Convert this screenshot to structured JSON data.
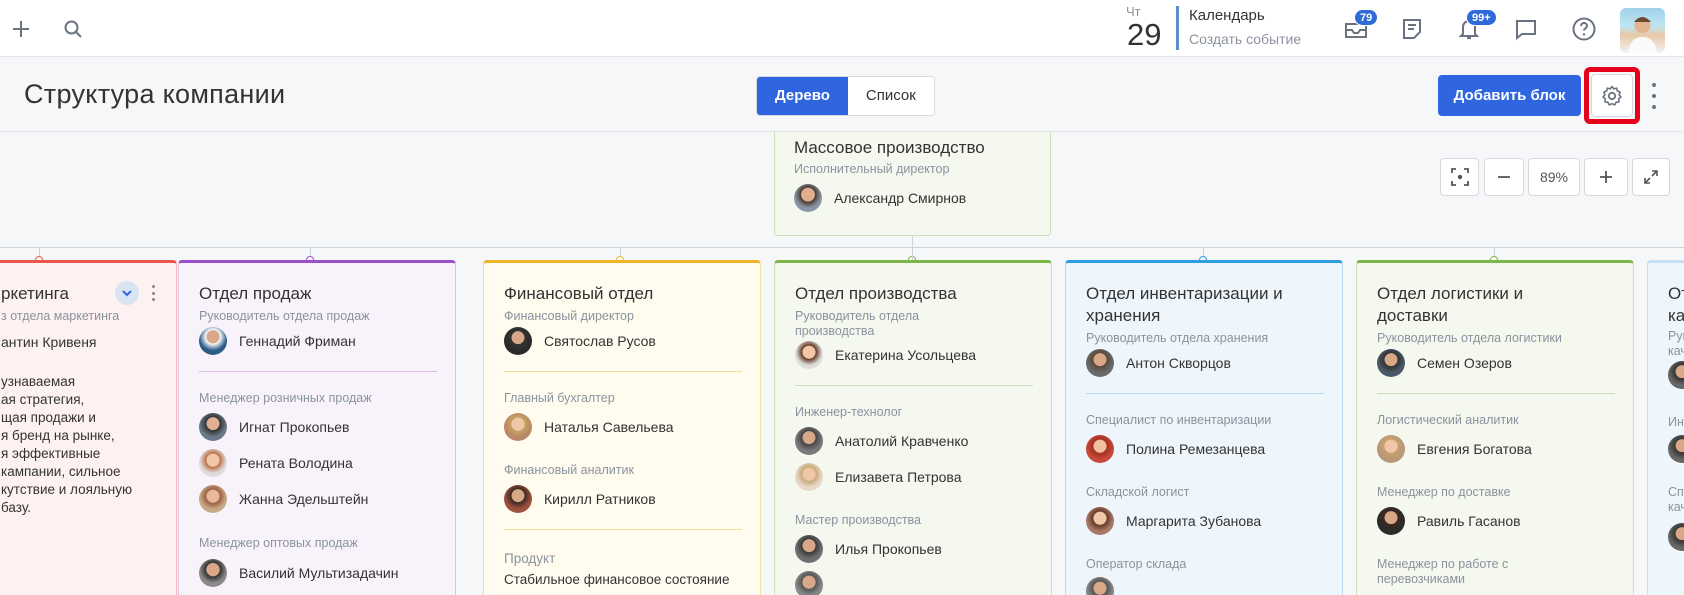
{
  "topbar": {
    "calendar": {
      "dow": "Чт",
      "day": "29",
      "title": "Календарь",
      "subtitle": "Создать событие"
    },
    "mail_badge": "79",
    "notif_badge": "99+"
  },
  "header": {
    "title": "Структура компании",
    "view_tabs": [
      "Дерево",
      "Список"
    ],
    "add_button": "Добавить блок"
  },
  "zoom": {
    "level": "89%"
  },
  "top_block": {
    "title": "Массовое производство",
    "role": "Исполнительный директор",
    "person": "Александр Смирнов"
  },
  "blocks": [
    {
      "title": "ркетинга",
      "role": "з отдела маркетинга",
      "head": "антин Кривеня",
      "text": "узнаваемая\nая стратегия,\nщая продажи и\nя бренд на рынке,\nя эффективные\nкампании, сильное\nкутствие и лояльную\nбазу."
    },
    {
      "title": "Отдел продаж",
      "role": "Руководитель отдела продаж",
      "head": "Геннадий Фриман",
      "groups": [
        {
          "role": "Менеджер розничных продаж",
          "people": [
            "Игнат Прокопьев",
            "Рената Володина",
            "Жанна Эдельштейн"
          ]
        },
        {
          "role": "Менеджер оптовых продаж",
          "people": [
            "Василий Мультизадачин"
          ]
        }
      ]
    },
    {
      "title": "Финансовый отдел",
      "role": "Финансовый директор",
      "head": "Святослав Русов",
      "groups": [
        {
          "role": "Главный бухгалтер",
          "people": [
            "Наталья Савельева"
          ]
        },
        {
          "role": "Финансовый аналитик",
          "people": [
            "Кирилл Ратников"
          ]
        }
      ],
      "product_label": "Продукт",
      "product_text": "Стабильное финансовое состояние"
    },
    {
      "title": "Отдел производства",
      "role": "Руководитель отдела производства",
      "head": "Екатерина Усольцева",
      "groups": [
        {
          "role": "Инженер-технолог",
          "people": [
            "Анатолий Кравченко",
            "Елизавета Петрова"
          ]
        },
        {
          "role": "Мастер производства",
          "people": [
            "Илья Прокопьев"
          ]
        }
      ]
    },
    {
      "title": "Отдел инвентаризации и хранения",
      "role": "Руководитель отдела хранения",
      "head": "Антон Скворцов",
      "groups": [
        {
          "role": "Специалист по инвентаризации",
          "people": [
            "Полина Ремезанцева"
          ]
        },
        {
          "role": "Складской логист",
          "people": [
            "Маргарита Зубанова"
          ]
        },
        {
          "role": "Оператор склада",
          "people": []
        }
      ]
    },
    {
      "title": "Отдел логистики и доставки",
      "role": "Руководитель отдела логистики",
      "head": "Семен Озеров",
      "groups": [
        {
          "role": "Логистический аналитик",
          "people": [
            "Евгения Богатова"
          ]
        },
        {
          "role": "Менеджер по доставке",
          "people": [
            "Равиль Гасанов"
          ]
        },
        {
          "role": "Менеджер по работе с перевозчиками",
          "people": []
        }
      ]
    },
    {
      "title": "От\nка",
      "role": "Рук\nкач",
      "r2": "Инж",
      "r3": "Спе\nкач"
    }
  ],
  "colors": {
    "accent": "#2f66e0",
    "highlight": "#e6001a",
    "marketing": "#e8574b",
    "sales": "#9b4fc8",
    "finance": "#f0b429",
    "production": "#7ab648",
    "inventory": "#2d9fe0",
    "logistics": "#7ab648"
  }
}
